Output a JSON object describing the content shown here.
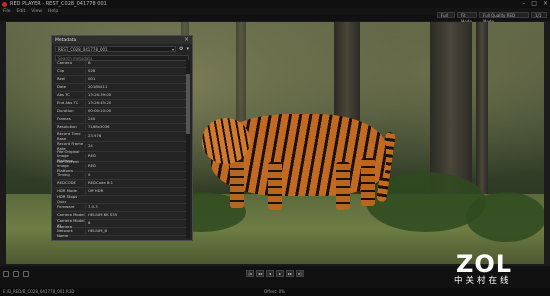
{
  "window": {
    "title": "RED PLAYER - REST_C028_041778 001"
  },
  "menu": [
    "File",
    "Edit",
    "View",
    "Help"
  ],
  "toolbar_dropdowns": [
    "Full",
    "Fit Mode",
    "Full Quality RED Mode",
    "1/1"
  ],
  "metadata_panel": {
    "title": "Metadata",
    "clip_select": "REST_C028_041778_001",
    "search_placeholder": "Search metadata",
    "rows": [
      {
        "key": "Camera",
        "value": "B"
      },
      {
        "key": "Clip",
        "value": "028"
      },
      {
        "key": "Reel",
        "value": "001"
      },
      {
        "key": "Date",
        "value": "20180411"
      },
      {
        "key": "Abs TC",
        "value": "13:26:39:00"
      },
      {
        "key": "End Abs TC",
        "value": "13:26:45:20"
      },
      {
        "key": "Duration",
        "value": "00:00:10:00"
      },
      {
        "key": "Frames",
        "value": "240"
      },
      {
        "key": "Resolution",
        "value": "7168x3036"
      },
      {
        "key": "Record Time Base",
        "value": "23.976"
      },
      {
        "key": "Record Frame Rate",
        "value": "24"
      },
      {
        "key": "File Original Image Platform",
        "value": "RED"
      },
      {
        "key": "File Current Image Platform",
        "value": "RED"
      },
      {
        "key": "Timing",
        "value": "0"
      },
      {
        "key": "REDCODE",
        "value": "REDCode 8:1"
      },
      {
        "key": "HDR Mode",
        "value": "Off HDR"
      },
      {
        "key": "HDR Stops Over",
        "value": ""
      },
      {
        "key": "Firmware",
        "value": "7.0.3"
      },
      {
        "key": "Camera Model",
        "value": "HELIUM 8K S35"
      },
      {
        "key": "Camera Model ID",
        "value": "8"
      },
      {
        "key": "Camera Network Name",
        "value": "HELIUM_B"
      }
    ]
  },
  "transport": [
    "|◂",
    "◂◂",
    "◂",
    "▸",
    "▸▸",
    "▸|"
  ],
  "status": {
    "left": "E:/B_RED/B_C028_041778_001.R3D",
    "middle": "Offset: 0%"
  },
  "watermark": {
    "brand": "ZOL",
    "tagline": "中关村在线"
  },
  "colors": {
    "accent": "#c62828",
    "panel_bg": "#242424",
    "background": "#1a1a1a"
  }
}
